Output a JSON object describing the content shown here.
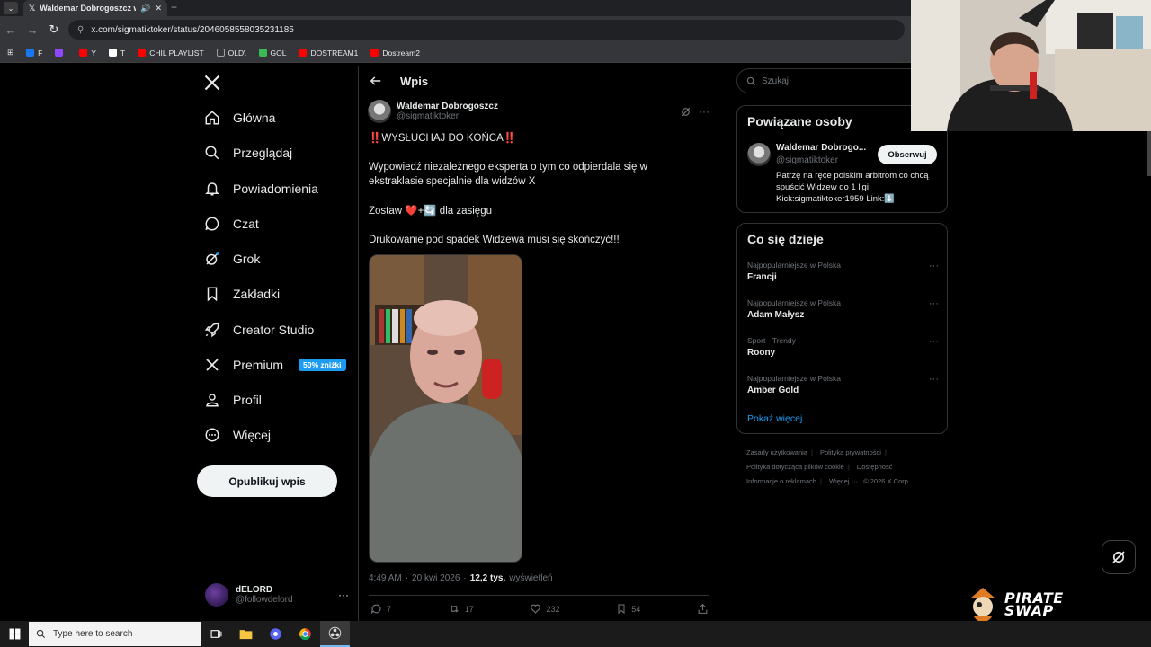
{
  "browser": {
    "tab_title": "Waldemar Dobrogoszcz w",
    "url": "x.com/sigmatiktoker/status/2046058558035231185",
    "bookmarks": [
      {
        "label": "F",
        "color": "#1877f2"
      },
      {
        "label": "",
        "color": "#9146ff"
      },
      {
        "label": "Y",
        "color": "#ff0000"
      },
      {
        "label": "T",
        "color": "#ffffff"
      },
      {
        "label": "CHIL PLAYLIST",
        "color": "#ff0000"
      },
      {
        "label": "OLD\\",
        "color": "#9aa0a6"
      },
      {
        "label": "GOL",
        "color": "#3cba54"
      },
      {
        "label": "DOSTREAM1",
        "color": "#ff0000"
      },
      {
        "label": "Dostream2",
        "color": "#ff0000"
      }
    ]
  },
  "nav": {
    "items": [
      {
        "label": "Główna",
        "icon": "home-icon"
      },
      {
        "label": "Przeglądaj",
        "icon": "search-icon"
      },
      {
        "label": "Powiadomienia",
        "icon": "bell-icon"
      },
      {
        "label": "Czat",
        "icon": "chat-icon"
      },
      {
        "label": "Grok",
        "icon": "grok-icon"
      },
      {
        "label": "Zakładki",
        "icon": "bookmark-icon"
      },
      {
        "label": "Creator Studio",
        "icon": "rocket-icon"
      },
      {
        "label": "Premium",
        "icon": "x-icon"
      },
      {
        "label": "Profil",
        "icon": "person-icon"
      },
      {
        "label": "Więcej",
        "icon": "more-circle-icon"
      }
    ],
    "premium_badge": "50% zniżki",
    "post_button": "Opublikuj wpis",
    "account": {
      "name": "dELORD",
      "handle": "@followdelord"
    }
  },
  "post": {
    "header_title": "Wpis",
    "author_name": "Waldemar Dobrogoszcz",
    "author_handle": "@sigmatiktoker",
    "lines": [
      "‼️WYSŁUCHAJ DO KOŃCA‼️",
      "Wypowiedź niezależnego eksperta o tym co odpierdala się w ekstraklasie specjalnie dla widzów X",
      "Zostaw ❤️+🔄 dla zasięgu",
      "Drukowanie pod spadek Widzewa musi się skończyć!!!"
    ],
    "time": "4:49 AM",
    "date": "20 kwi 2026",
    "views_count": "12,2 tys.",
    "views_label": "wyświetleń",
    "replies": "7",
    "reposts": "17",
    "likes": "232",
    "bookmarks": "54"
  },
  "sidebar": {
    "search_placeholder": "Szukaj",
    "related_title": "Powiązane osoby",
    "related_name": "Waldemar Dobrogo...",
    "related_handle": "@sigmatiktoker",
    "related_bio": "Patrzę na ręce polskim arbitrom co chcą spuścić Widzew do 1 ligi Kick:sigmatiktoker1959 Link:⬇️",
    "follow_label": "Obserwuj",
    "trends_title": "Co się dzieje",
    "trends": [
      {
        "context": "Najpopularniejsze w Polska",
        "name": "Francji"
      },
      {
        "context": "Najpopularniejsze w Polska",
        "name": "Adam Małysz"
      },
      {
        "context": "Sport · Trendy",
        "name": "Roony"
      },
      {
        "context": "Najpopularniejsze w Polska",
        "name": "Amber Gold"
      }
    ],
    "show_more": "Pokaż więcej",
    "footer_links": [
      "Zasady użytkowania",
      "Polityka prywatności",
      "Polityka dotycząca plików cookie",
      "Dostępność",
      "Informacje o reklamach",
      "Więcej ···",
      "© 2026 X Corp."
    ]
  },
  "overlay": {
    "brand_line1": "PIRATE",
    "brand_line2": "SWAP"
  },
  "taskbar": {
    "search_placeholder": "Type here to search"
  },
  "colors": {
    "accent": "#1d9bf0",
    "background": "#000000",
    "border": "#2f3336",
    "secondary_text": "#71767b"
  }
}
